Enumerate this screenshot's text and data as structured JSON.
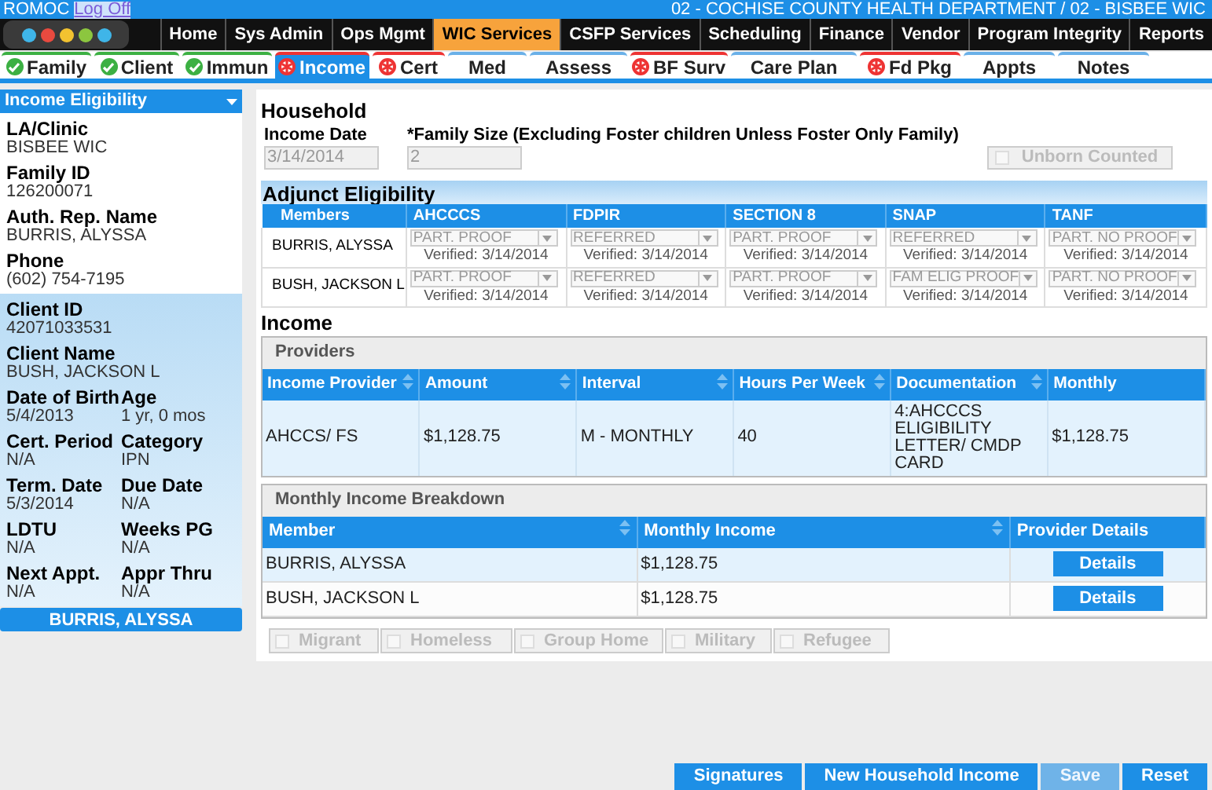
{
  "header": {
    "user": "ROMOC",
    "logoff": "Log Off",
    "agency": "02 - COCHISE COUNTY HEALTH DEPARTMENT / 02 - BISBEE WIC"
  },
  "nav": [
    {
      "label": "Home",
      "selected": false
    },
    {
      "label": "Sys Admin",
      "selected": false
    },
    {
      "label": "Ops Mgmt",
      "selected": false
    },
    {
      "label": "WIC Services",
      "selected": true
    },
    {
      "label": "CSFP Services",
      "selected": false
    },
    {
      "label": "Scheduling",
      "selected": false
    },
    {
      "label": "Finance",
      "selected": false
    },
    {
      "label": "Vendor",
      "selected": false
    },
    {
      "label": "Program Integrity",
      "selected": false
    },
    {
      "label": "Reports",
      "selected": false
    }
  ],
  "tabs": [
    {
      "label": "Family",
      "kind": "done",
      "selected": false
    },
    {
      "label": "Client",
      "kind": "done",
      "selected": false
    },
    {
      "label": "Immun",
      "kind": "done",
      "selected": false
    },
    {
      "label": "Income",
      "kind": "required",
      "selected": true
    },
    {
      "label": "Cert",
      "kind": "required",
      "selected": false
    },
    {
      "label": "Med",
      "kind": "plain",
      "selected": false
    },
    {
      "label": "Assess",
      "kind": "plain",
      "selected": false
    },
    {
      "label": "BF Surv",
      "kind": "required",
      "selected": false
    },
    {
      "label": "Care Plan",
      "kind": "plain",
      "selected": false
    },
    {
      "label": "Fd Pkg",
      "kind": "required",
      "selected": false
    },
    {
      "label": "Appts",
      "kind": "plain",
      "selected": false
    },
    {
      "label": "Notes",
      "kind": "plain",
      "selected": false
    }
  ],
  "sidebar": {
    "dropdown": "Income Eligibility",
    "family_fields": [
      {
        "label": "LA/Clinic",
        "value": "BISBEE WIC"
      },
      {
        "label": "Family ID",
        "value": "126200071"
      },
      {
        "label": "Auth. Rep. Name",
        "value": "BURRIS, ALYSSA"
      },
      {
        "label": "Phone",
        "value": "(602) 754-7195"
      }
    ],
    "client_fields": [
      [
        {
          "label": "Client ID",
          "value": "42071033531"
        }
      ],
      [
        {
          "label": "Client Name",
          "value": "BUSH, JACKSON L"
        }
      ],
      [
        {
          "label": "Date of Birth",
          "value": "5/4/2013"
        },
        {
          "label": "Age",
          "value": "1 yr, 0 mos"
        }
      ],
      [
        {
          "label": "Cert. Period",
          "value": "N/A"
        },
        {
          "label": "Category",
          "value": "IPN"
        }
      ],
      [
        {
          "label": "Term. Date",
          "value": "5/3/2014"
        },
        {
          "label": "Due Date",
          "value": "N/A"
        }
      ],
      [
        {
          "label": "LDTU",
          "value": "N/A"
        },
        {
          "label": "Weeks PG",
          "value": "N/A"
        }
      ],
      [
        {
          "label": "Next Appt.",
          "value": "N/A"
        },
        {
          "label": "Appr Thru",
          "value": "N/A"
        }
      ]
    ],
    "member_button": "BURRIS, ALYSSA"
  },
  "household": {
    "title": "Household",
    "income_date": {
      "label": "Income Date",
      "value": "3/14/2014"
    },
    "family_size": {
      "label": "*Family Size (Excluding Foster children Unless Foster Only Family)",
      "value": "2"
    },
    "unborn": {
      "label": "Unborn Counted",
      "checked": false
    }
  },
  "adjunct": {
    "title": "Adjunct Eligibility",
    "member_column": "Members",
    "columns": [
      "AHCCCS",
      "FDPIR",
      "SECTION 8",
      "SNAP",
      "TANF"
    ],
    "rows": [
      {
        "member": "BURRIS, ALYSSA",
        "cells": [
          {
            "value": "PART. PROOF",
            "verified": "Verified: 3/14/2014"
          },
          {
            "value": "REFERRED",
            "verified": "Verified: 3/14/2014"
          },
          {
            "value": "PART. PROOF",
            "verified": "Verified: 3/14/2014"
          },
          {
            "value": "REFERRED",
            "verified": "Verified: 3/14/2014"
          },
          {
            "value": "PART. NO PROOF",
            "verified": "Verified: 3/14/2014"
          }
        ]
      },
      {
        "member": "BUSH, JACKSON L",
        "cells": [
          {
            "value": "PART. PROOF",
            "verified": "Verified: 3/14/2014"
          },
          {
            "value": "REFERRED",
            "verified": "Verified: 3/14/2014"
          },
          {
            "value": "PART. PROOF",
            "verified": "Verified: 3/14/2014"
          },
          {
            "value": "FAM ELIG PROOF",
            "verified": "Verified: 3/14/2014"
          },
          {
            "value": "PART. NO PROOF",
            "verified": "Verified: 3/14/2014"
          }
        ]
      }
    ]
  },
  "income": {
    "title": "Income",
    "providers": {
      "title": "Providers",
      "columns": [
        "Income Provider",
        "Amount",
        "Interval",
        "Hours Per Week",
        "Documentation",
        "Monthly"
      ],
      "rows": [
        [
          "AHCCS/ FS",
          "$1,128.75",
          "M - MONTHLY",
          "40",
          "4:AHCCCS ELIGIBILITY LETTER/ CMDP CARD",
          "$1,128.75"
        ]
      ]
    },
    "breakdown": {
      "title": "Monthly Income Breakdown",
      "columns": [
        "Member",
        "Monthly Income",
        "Provider Details"
      ],
      "rows": [
        {
          "member": "BURRIS, ALYSSA",
          "income": "$1,128.75",
          "button": "Details"
        },
        {
          "member": "BUSH, JACKSON L",
          "income": "$1,128.75",
          "button": "Details"
        }
      ]
    }
  },
  "flags": [
    {
      "label": "Migrant",
      "checked": false
    },
    {
      "label": "Homeless",
      "checked": false
    },
    {
      "label": "Group Home",
      "checked": false
    },
    {
      "label": "Military",
      "checked": false
    },
    {
      "label": "Refugee",
      "checked": false
    }
  ],
  "buttons": [
    {
      "label": "Signatures",
      "disabled": false
    },
    {
      "label": "New Household Income",
      "disabled": false
    },
    {
      "label": "Save",
      "disabled": true
    },
    {
      "label": "Reset",
      "disabled": false
    }
  ]
}
